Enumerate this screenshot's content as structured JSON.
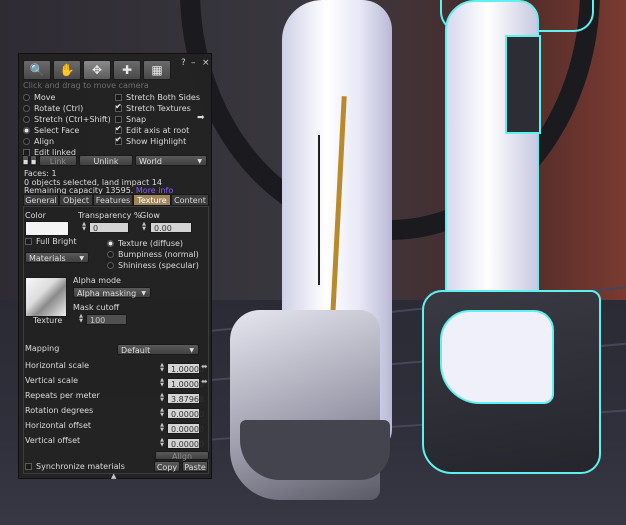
{
  "toolbar": {
    "tools": [
      {
        "name": "focus-tool",
        "glyph": "🔍"
      },
      {
        "name": "move-tool",
        "glyph": "✋"
      },
      {
        "name": "edit-tool",
        "glyph": "✥"
      },
      {
        "name": "create-tool",
        "glyph": "✚"
      },
      {
        "name": "land-tool",
        "glyph": "▦"
      }
    ],
    "help": "?",
    "minimize": "–",
    "close": "×"
  },
  "hint": "Click and drag to move camera",
  "options": {
    "move": "Move",
    "rotate": "Rotate (Ctrl)",
    "stretch": "Stretch (Ctrl+Shift)",
    "select_face": "Select Face",
    "align": "Align",
    "edit_linked": "Edit linked",
    "stretch_both": "Stretch Both Sides",
    "stretch_textures": "Stretch Textures",
    "snap": "Snap",
    "edit_axis": "Edit axis at root",
    "show_highlight": "Show Highlight"
  },
  "link_bar": {
    "link": "Link",
    "unlink": "Unlink",
    "world": "World"
  },
  "info": {
    "faces": "Faces: 1",
    "selected": "0 objects selected, land impact 14",
    "capacity": "Remaining capacity 13595.",
    "more_info": "More info"
  },
  "tabs": [
    "General",
    "Object",
    "Features",
    "Texture",
    "Content"
  ],
  "texture": {
    "color_label": "Color",
    "transparency_label": "Transparency %",
    "transparency_value": "0",
    "glow_label": "Glow",
    "glow_value": "0.00",
    "full_bright": "Full Bright",
    "materials": "Materials",
    "texture_diffuse": "Texture (diffuse)",
    "bumpiness": "Bumpiness (normal)",
    "shininess": "Shininess (specular)",
    "alpha_mode_label": "Alpha mode",
    "alpha_mode_value": "Alpha masking",
    "mask_cutoff_label": "Mask cutoff",
    "mask_cutoff_value": "100",
    "texture_label": "Texture",
    "mapping_label": "Mapping",
    "mapping_value": "Default",
    "horizontal_scale_label": "Horizontal scale",
    "horizontal_scale_value": "1.00000",
    "vertical_scale_label": "Vertical scale",
    "vertical_scale_value": "1.00000",
    "repeats_label": "Repeats per meter",
    "repeats_value": "3.87968",
    "rotation_label": "Rotation degrees",
    "rotation_value": "0.00000",
    "h_offset_label": "Horizontal offset",
    "h_offset_value": "0.00000",
    "v_offset_label": "Vertical offset",
    "v_offset_value": "0.00000",
    "align_button": "Align",
    "sync_materials": "Synchronize materials",
    "copy": "Copy",
    "paste": "Paste"
  },
  "colors": {
    "selected_tab": "#a0855a",
    "highlight_outline": "#5ff0f0",
    "link_text": "#8c5cff"
  }
}
